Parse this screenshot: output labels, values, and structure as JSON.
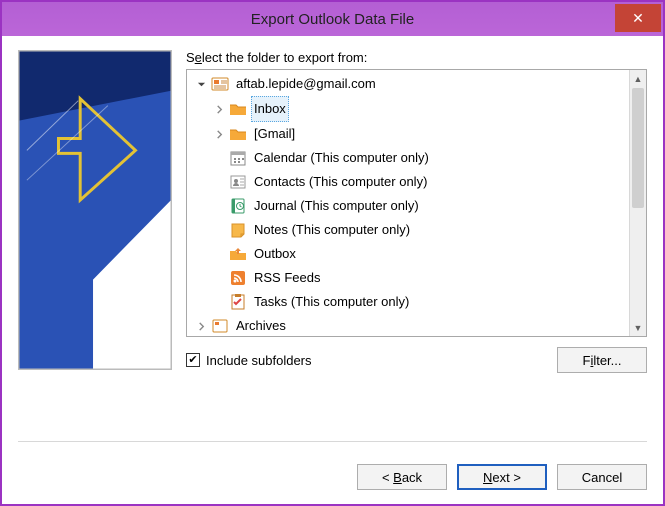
{
  "window": {
    "title": "Export Outlook Data File",
    "close": "✕"
  },
  "prompt": {
    "prefix": "S",
    "ul": "e",
    "rest": "lect the folder to export from:"
  },
  "tree": {
    "root": {
      "label": "aftab.lepide@gmail.com",
      "expanded": true,
      "children": [
        {
          "id": "inbox",
          "label": "Inbox",
          "expandable": true,
          "selected": true
        },
        {
          "id": "gmail",
          "label": "[Gmail]",
          "expandable": true
        },
        {
          "id": "calendar",
          "label": "Calendar (This computer only)"
        },
        {
          "id": "contacts",
          "label": "Contacts (This computer only)"
        },
        {
          "id": "journal",
          "label": "Journal (This computer only)"
        },
        {
          "id": "notes",
          "label": "Notes (This computer only)"
        },
        {
          "id": "outbox",
          "label": "Outbox"
        },
        {
          "id": "rss",
          "label": "RSS Feeds"
        },
        {
          "id": "tasks",
          "label": "Tasks (This computer only)"
        }
      ]
    },
    "sibling": {
      "id": "archives",
      "label": "Archives",
      "expandable": true
    }
  },
  "include": {
    "checked": true,
    "label": "Include subfolders",
    "ul_char": "I"
  },
  "filter_label": {
    "ul": "i",
    "before": "F",
    "after": "lter..."
  },
  "buttons": {
    "back": {
      "text": "< Back",
      "ul": "B"
    },
    "next": {
      "text": "Next >",
      "ul": "N"
    },
    "cancel": "Cancel"
  }
}
